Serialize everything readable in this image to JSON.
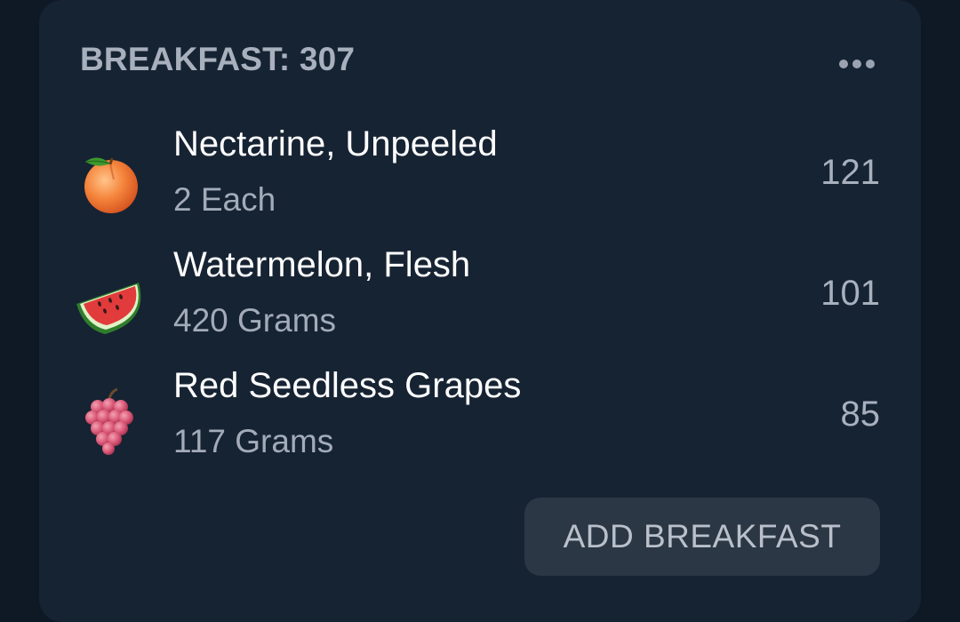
{
  "meal": {
    "title": "BREAKFAST: 307",
    "more_icon": "more-horizontal-icon",
    "items": [
      {
        "name": "Nectarine, Unpeeled",
        "quantity": "2 Each",
        "calories": "121",
        "icon": "nectarine-icon"
      },
      {
        "name": "Watermelon, Flesh",
        "quantity": "420 Grams",
        "calories": "101",
        "icon": "watermelon-icon"
      },
      {
        "name": "Red Seedless Grapes",
        "quantity": "117 Grams",
        "calories": "85",
        "icon": "grapes-icon"
      }
    ],
    "add_button_label": "ADD BREAKFAST"
  },
  "colors": {
    "background": "#0f1925",
    "card": "#162333",
    "button": "#2c3745",
    "primary_text": "#ffffff",
    "secondary_text": "#a3abb8"
  }
}
